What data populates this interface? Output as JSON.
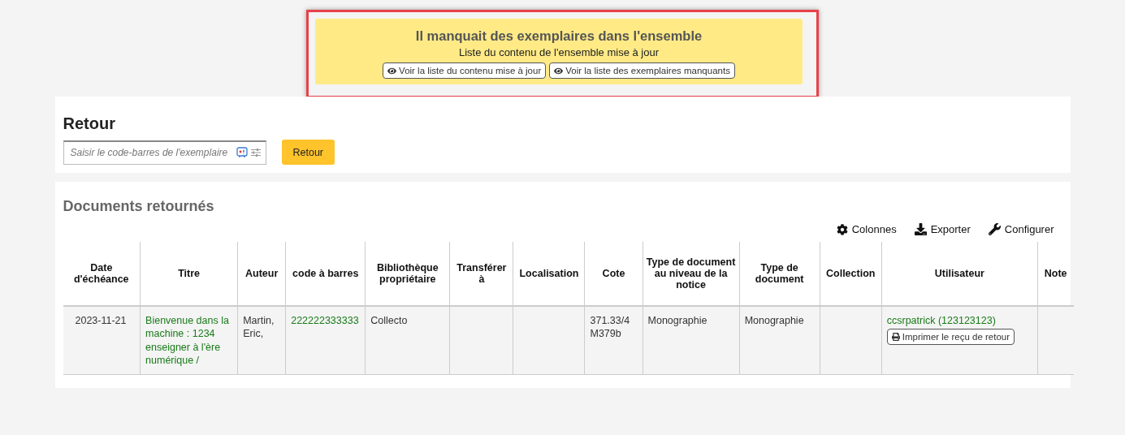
{
  "alert": {
    "title": "Il manquait des exemplaires dans l'ensemble",
    "message": "Liste du contenu de l'ensemble mise à jour",
    "buttons": [
      "Voir la liste du contenu mise à jour",
      "Voir la liste des exemplaires manquants"
    ]
  },
  "checkin": {
    "title": "Retour",
    "placeholder": "Saisir le code-barres de l'exemplaire",
    "button": "Retour"
  },
  "returned": {
    "title": "Documents retournés",
    "toolbar": [
      {
        "kind": "columns",
        "label": "Colonnes"
      },
      {
        "kind": "export",
        "label": "Exporter"
      },
      {
        "kind": "configure",
        "label": "Configurer"
      }
    ],
    "columns": [
      "Date d'échéance",
      "Titre",
      "Auteur",
      "code à barres",
      "Bibliothèque propriétaire",
      "Transférer à",
      "Localisation",
      "Cote",
      "Type de document au niveau de la notice",
      "Type de document",
      "Collection",
      "Utilisateur",
      "Note"
    ],
    "rows": [
      {
        "cells": [
          {
            "kind": "text",
            "text": "2023-11-21"
          },
          {
            "kind": "link",
            "text": "Bienvenue dans la machine : 1234 enseigner à l'ère numérique /"
          },
          {
            "kind": "text",
            "text": "Martin, Eric,"
          },
          {
            "kind": "link",
            "text": "222222333333"
          },
          {
            "kind": "text",
            "text": "Collecto"
          },
          {
            "kind": "empty"
          },
          {
            "kind": "empty"
          },
          {
            "kind": "text",
            "text": "371.33/4 M379b"
          },
          {
            "kind": "text",
            "text": "Monographie"
          },
          {
            "kind": "text",
            "text": "Monographie"
          },
          {
            "kind": "empty"
          },
          {
            "kind": "user",
            "text": "ccsrpatrick (123123123)",
            "button": "Imprimer le reçu de retour"
          },
          {
            "kind": "empty"
          }
        ]
      }
    ]
  }
}
